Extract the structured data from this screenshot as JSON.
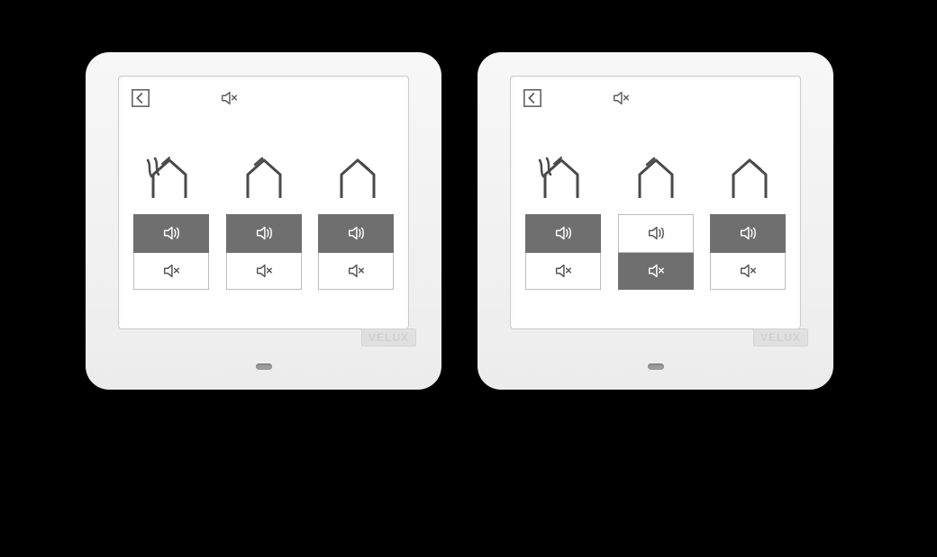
{
  "brand": "VELUX",
  "icons": {
    "back": "chevron-left-box-icon",
    "header_mute": "speaker-muted-icon",
    "mode_vent": "house-vent-icon",
    "mode_open": "house-open-icon",
    "mode_closed": "house-closed-icon",
    "sound_on": "speaker-on-icon",
    "sound_off": "speaker-muted-icon"
  },
  "devices": [
    {
      "id": "left",
      "modes": [
        {
          "name": "ventilation",
          "sound_on_active": true
        },
        {
          "name": "open",
          "sound_on_active": true
        },
        {
          "name": "closed",
          "sound_on_active": true
        }
      ]
    },
    {
      "id": "right",
      "modes": [
        {
          "name": "ventilation",
          "sound_on_active": true
        },
        {
          "name": "open",
          "sound_on_active": false
        },
        {
          "name": "closed",
          "sound_on_active": true
        }
      ]
    }
  ]
}
